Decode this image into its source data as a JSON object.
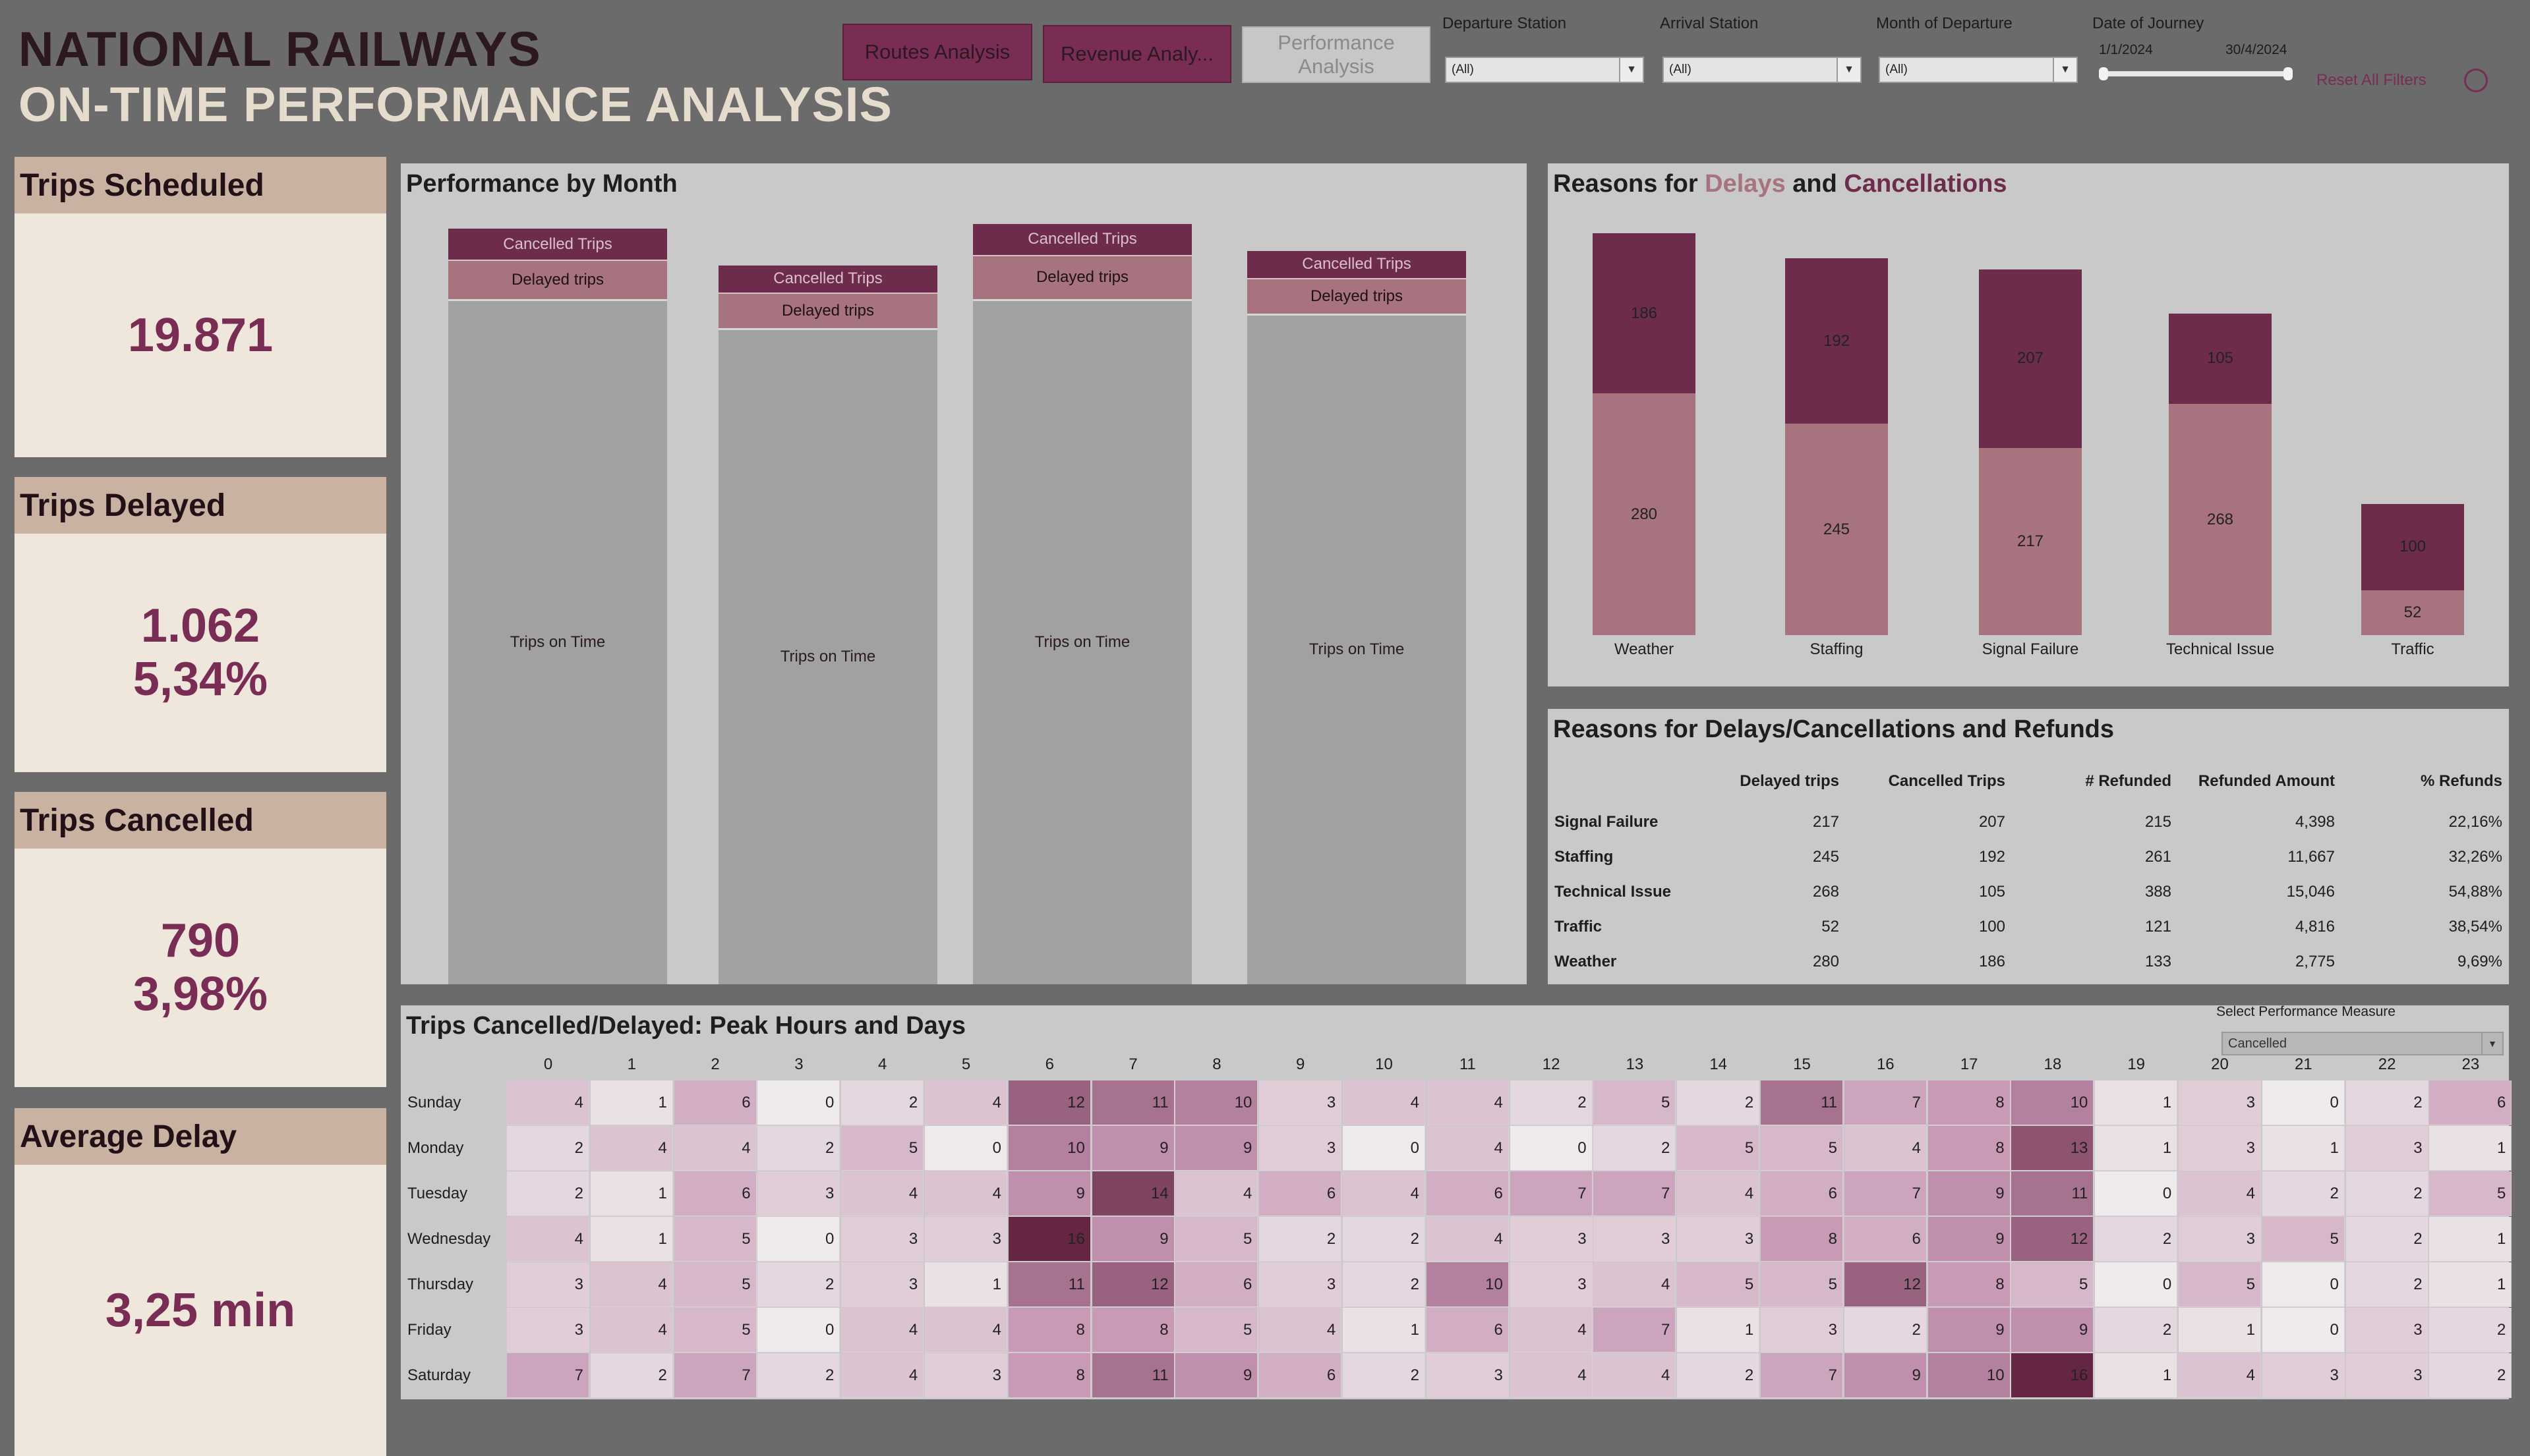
{
  "header": {
    "title_line1": "NATIONAL RAILWAYS",
    "title_line2": "ON-TIME PERFORMANCE ANALYSIS"
  },
  "nav": {
    "routes": "Routes Analysis",
    "revenue": "Revenue Analy...",
    "performance": "Performance Analysis"
  },
  "filters": {
    "departure_label": "Departure Station",
    "departure_value": "(All)",
    "arrival_label": "Arrival Station",
    "arrival_value": "(All)",
    "month_label": "Month of Departure",
    "month_value": "(All)",
    "date_label": "Date of Journey",
    "date_start": "1/1/2024",
    "date_end": "30/4/2024",
    "reset": "Reset All Filters"
  },
  "kpis": {
    "scheduled": {
      "label": "Trips Scheduled",
      "value": "19.871"
    },
    "delayed": {
      "label": "Trips Delayed",
      "value": "1.062",
      "pct": "5,34%"
    },
    "cancelled": {
      "label": "Trips Cancelled",
      "value": "790",
      "pct": "3,98%"
    },
    "avg_delay": {
      "label": "Average Delay",
      "value": "3,25 min"
    }
  },
  "month_panel": {
    "title": "Performance by Month",
    "cancelled_label": "Cancelled Trips",
    "delayed_label": "Delayed trips",
    "ontime_label": "Trips on Time"
  },
  "reasons_panel": {
    "title_prefix": "Reasons for ",
    "title_delays": "Delays",
    "title_and": " and ",
    "title_cancellations": "Cancellations",
    "color_delays": "#a6737e",
    "color_cancellations": "#6e2c4d"
  },
  "chart_data": [
    {
      "type": "bar",
      "stacked": true,
      "categories": [
        "",
        "",
        "",
        ""
      ],
      "series": [
        {
          "name": "Trips on Time",
          "values": [
            4700,
            4500,
            4700,
            4600
          ]
        },
        {
          "name": "Delayed trips",
          "values": [
            270,
            245,
            300,
            245
          ]
        },
        {
          "name": "Cancelled Trips",
          "values": [
            210,
            185,
            215,
            185
          ]
        }
      ]
    },
    {
      "type": "bar",
      "stacked": true,
      "categories": [
        "Weather",
        "Staffing",
        "Signal Failure",
        "Technical Issue",
        "Traffic"
      ],
      "series": [
        {
          "name": "Delays",
          "values": [
            280,
            245,
            217,
            268,
            52
          ]
        },
        {
          "name": "Cancellations",
          "values": [
            186,
            192,
            207,
            105,
            100
          ]
        }
      ]
    }
  ],
  "refunds_table": {
    "title": "Reasons for Delays/Cancellations and Refunds",
    "columns": [
      "Delayed trips",
      "Cancelled Trips",
      "# Refunded",
      "Refunded Amount",
      "% Refunds"
    ],
    "rows": [
      {
        "reason": "Signal Failure",
        "cells": [
          "217",
          "207",
          "215",
          "4,398",
          "22,16%"
        ]
      },
      {
        "reason": "Staffing",
        "cells": [
          "245",
          "192",
          "261",
          "11,667",
          "32,26%"
        ]
      },
      {
        "reason": "Technical Issue",
        "cells": [
          "268",
          "105",
          "388",
          "15,046",
          "54,88%"
        ]
      },
      {
        "reason": "Traffic",
        "cells": [
          "52",
          "100",
          "121",
          "4,816",
          "38,54%"
        ]
      },
      {
        "reason": "Weather",
        "cells": [
          "280",
          "186",
          "133",
          "2,775",
          "9,69%"
        ]
      }
    ]
  },
  "heatmap": {
    "title": "Trips Cancelled/Delayed: Peak Hours and Days",
    "measure_label": "Select Performance Measure",
    "measure_value": "Cancelled",
    "hours": [
      "0",
      "1",
      "2",
      "3",
      "4",
      "5",
      "6",
      "7",
      "8",
      "9",
      "10",
      "11",
      "12",
      "13",
      "14",
      "15",
      "16",
      "17",
      "18",
      "19",
      "20",
      "21",
      "22",
      "23"
    ],
    "days": [
      "Sunday",
      "Monday",
      "Tuesday",
      "Wednesday",
      "Thursday",
      "Friday",
      "Saturday"
    ],
    "values": [
      [
        4,
        1,
        6,
        0,
        2,
        4,
        12,
        11,
        10,
        3,
        4,
        4,
        2,
        5,
        2,
        11,
        7,
        8,
        10,
        1,
        3,
        0,
        2,
        6
      ],
      [
        2,
        4,
        4,
        2,
        5,
        0,
        10,
        9,
        9,
        3,
        0,
        4,
        0,
        2,
        5,
        5,
        4,
        8,
        13,
        1,
        3,
        1,
        3,
        1
      ],
      [
        2,
        1,
        6,
        3,
        4,
        4,
        9,
        14,
        4,
        6,
        4,
        6,
        7,
        7,
        4,
        6,
        7,
        9,
        11,
        0,
        4,
        2,
        2,
        5
      ],
      [
        4,
        1,
        5,
        0,
        3,
        3,
        16,
        9,
        5,
        2,
        2,
        4,
        3,
        3,
        3,
        8,
        6,
        9,
        12,
        2,
        3,
        5,
        2,
        1
      ],
      [
        3,
        4,
        5,
        2,
        3,
        1,
        11,
        12,
        6,
        3,
        2,
        10,
        3,
        4,
        5,
        5,
        12,
        8,
        5,
        0,
        5,
        0,
        2,
        1
      ],
      [
        3,
        4,
        5,
        0,
        4,
        4,
        8,
        8,
        5,
        4,
        1,
        6,
        4,
        7,
        1,
        3,
        2,
        9,
        9,
        2,
        1,
        0,
        3,
        2
      ],
      [
        7,
        2,
        7,
        2,
        4,
        3,
        8,
        11,
        9,
        6,
        2,
        3,
        4,
        4,
        2,
        7,
        9,
        10,
        16,
        1,
        4,
        3,
        3,
        2
      ]
    ]
  }
}
